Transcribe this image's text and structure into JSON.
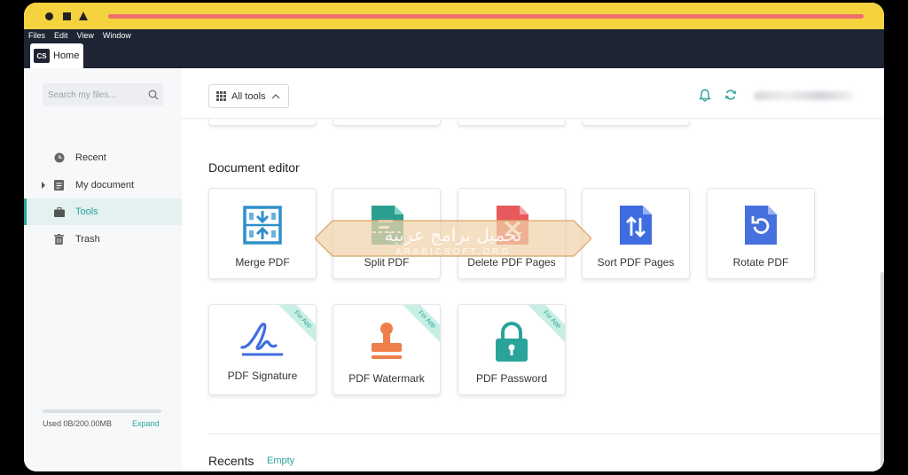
{
  "menubar": {
    "items": [
      "Files",
      "Edit",
      "View",
      "Window"
    ]
  },
  "tab": {
    "logo": "CS",
    "label": "Home"
  },
  "sidebar": {
    "search_placeholder": "Search my files...",
    "items": [
      {
        "label": "Recent",
        "icon": "clock-icon"
      },
      {
        "label": "My document",
        "icon": "document-icon"
      },
      {
        "label": "Tools",
        "icon": "briefcase-icon",
        "active": true
      },
      {
        "label": "Trash",
        "icon": "trash-icon"
      }
    ],
    "storage_text": "Used 0B/200.00MB",
    "storage_fraction": 0.0,
    "expand_label": "Expand"
  },
  "toolbar": {
    "all_tools_label": "All tools"
  },
  "section": {
    "title": "Document editor",
    "tools": [
      {
        "label": "Merge PDF",
        "icon": "merge-icon"
      },
      {
        "label": "Split PDF",
        "icon": "split-icon"
      },
      {
        "label": "Delete PDF Pages",
        "icon": "delete-pages-icon"
      },
      {
        "label": "Sort PDF Pages",
        "icon": "sort-icon"
      },
      {
        "label": "Rotate PDF",
        "icon": "rotate-icon"
      },
      {
        "label": "PDF Signature",
        "icon": "signature-icon",
        "ribbon": "For App"
      },
      {
        "label": "PDF Watermark",
        "icon": "stamp-icon",
        "ribbon": "For App"
      },
      {
        "label": "PDF Password",
        "icon": "lock-icon",
        "ribbon": "For App"
      }
    ]
  },
  "recents": {
    "title": "Recents",
    "empty_label": "Empty"
  },
  "watermark": {
    "arabic": "تحميل برامج عربية",
    "latin": "ARABICSOFT.ORG"
  },
  "colors": {
    "accent": "#2aa39a",
    "titlebar": "#f5d33f",
    "dark": "#1e2433"
  }
}
